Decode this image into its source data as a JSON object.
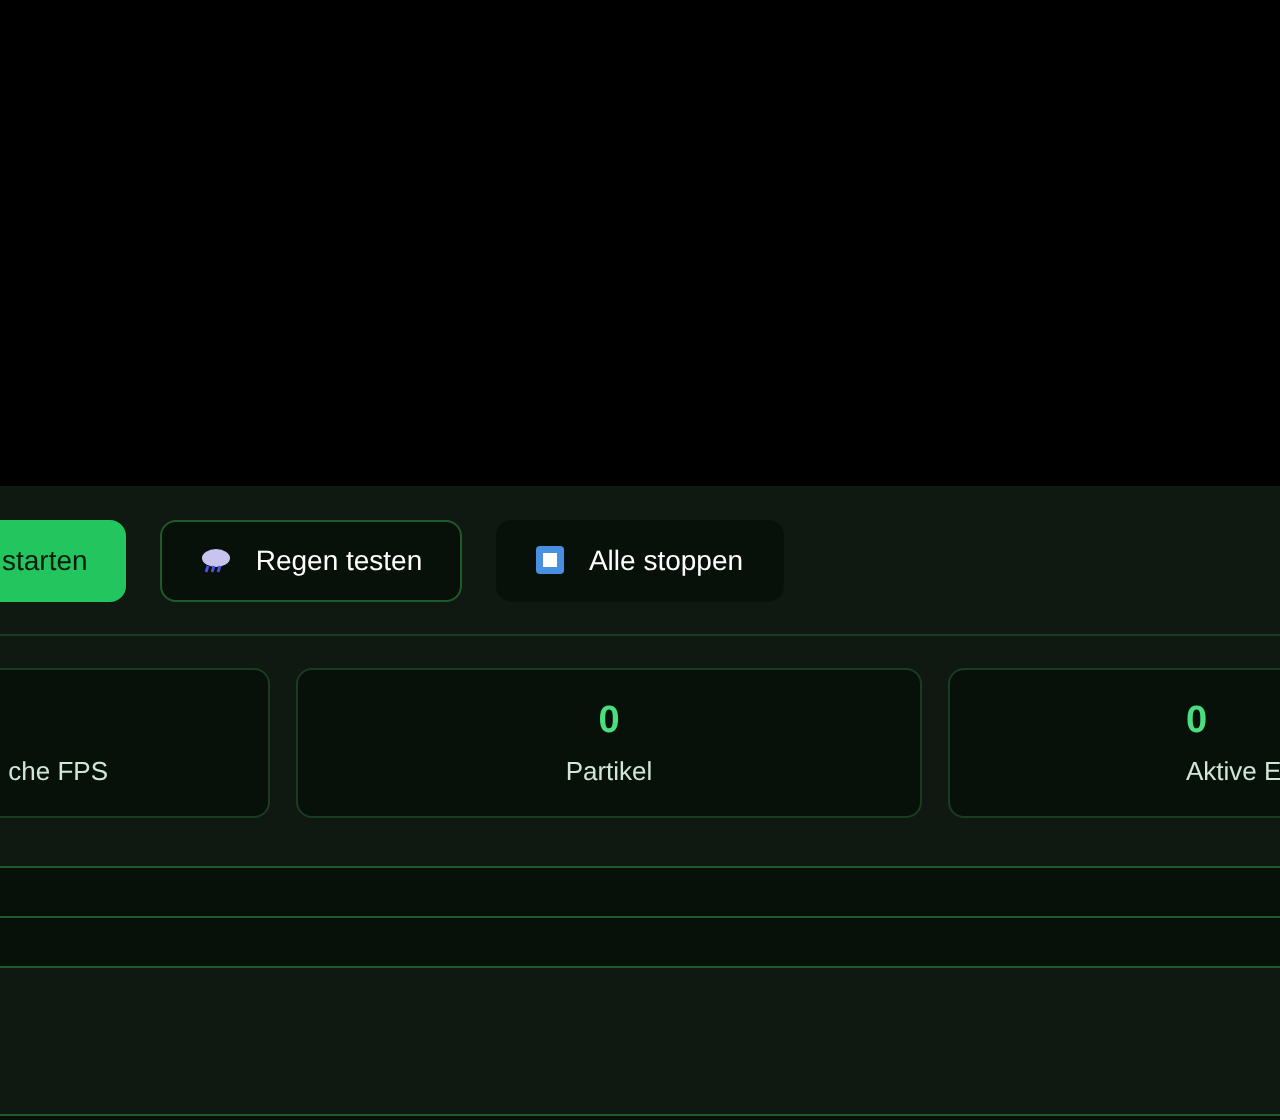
{
  "buttons": [
    {
      "label": "starten",
      "kind": "primary"
    },
    {
      "label": "Regen testen",
      "kind": "outline"
    },
    {
      "label": "Alle stoppen",
      "kind": "dark"
    }
  ],
  "stats": [
    {
      "label": "che FPS"
    },
    {
      "value": "0",
      "label": "Partikel"
    },
    {
      "value": "0",
      "label": "Aktive E"
    }
  ]
}
